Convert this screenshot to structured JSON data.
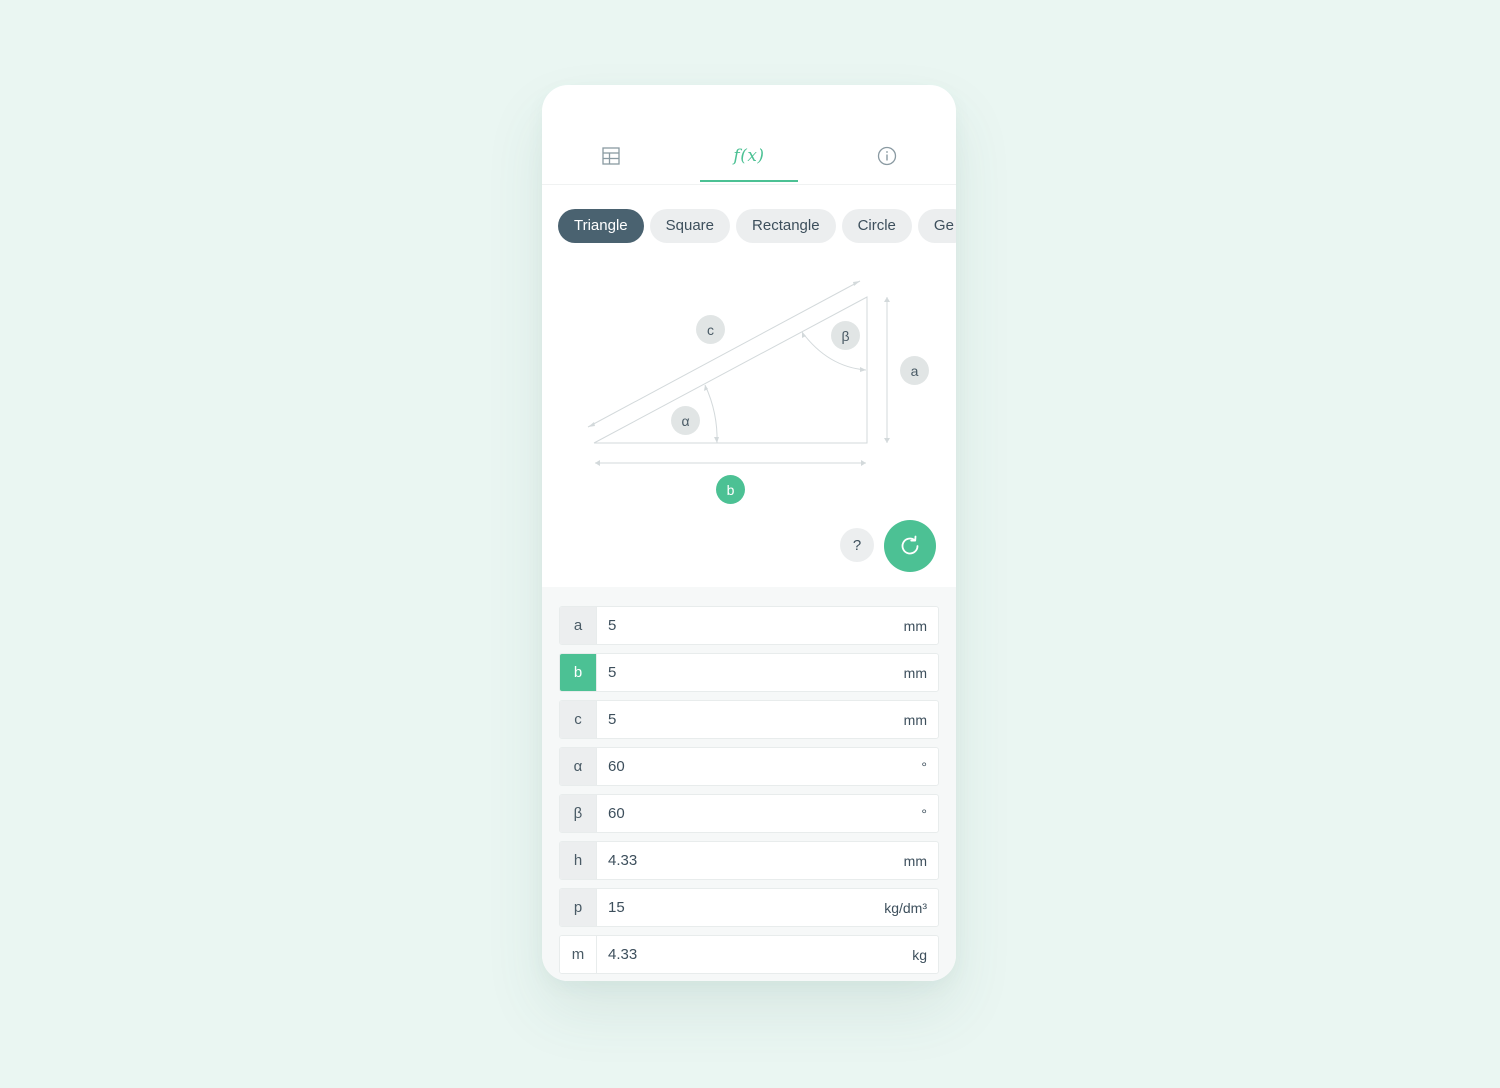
{
  "tabs": [
    {
      "name": "table",
      "icon": "table-icon"
    },
    {
      "name": "formula",
      "label": "f(x)",
      "active": true
    },
    {
      "name": "info",
      "icon": "info-icon"
    }
  ],
  "shapes": [
    "Triangle",
    "Square",
    "Rectangle",
    "Circle",
    "Ge"
  ],
  "selected_shape": "Triangle",
  "diagram": {
    "labels": {
      "c": "c",
      "beta": "β",
      "a": "a",
      "alpha": "α",
      "b": "b"
    },
    "highlighted": "b"
  },
  "actions": {
    "help_label": "?",
    "refresh_icon": "refresh-icon"
  },
  "fields": [
    {
      "label": "a",
      "value": "5",
      "unit": "mm"
    },
    {
      "label": "b",
      "value": "5",
      "unit": "mm"
    },
    {
      "label": "c",
      "value": "5",
      "unit": "mm"
    },
    {
      "label": "α",
      "value": "60",
      "unit": "°"
    },
    {
      "label": "β",
      "value": "60",
      "unit": "°"
    },
    {
      "label": "h",
      "value": "4.33",
      "unit": "mm"
    },
    {
      "label": "p",
      "value": "15",
      "unit": "kg/dm³"
    },
    {
      "label": "m",
      "value": "4.33",
      "unit": "kg"
    }
  ],
  "colors": {
    "accent": "#4cc194",
    "chip_active": "#4a6270",
    "background": "#eaf6f2"
  }
}
